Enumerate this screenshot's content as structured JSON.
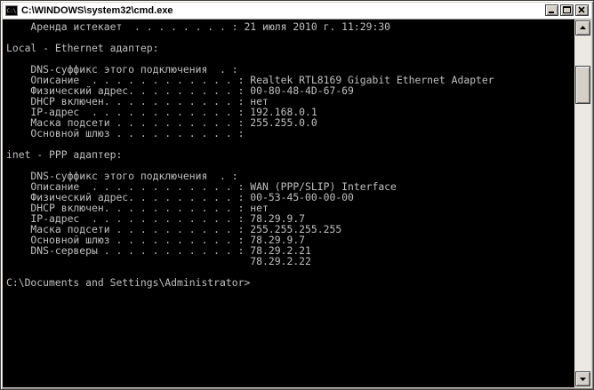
{
  "window": {
    "title": "C:\\WINDOWS\\system32\\cmd.exe",
    "icon_label": "C:\\"
  },
  "console": {
    "lines": [
      "    Аренда истекает  . . . . . . . . : 21 июля 2010 г. 11:29:30",
      "",
      "Local - Ethernet адаптер:",
      "",
      "    DNS-суффикс этого подключения  . :",
      "    Описание  . . . . . . . . . . . . : Realtek RTL8169 Gigabit Ethernet Adapter",
      "    Физический адрес. . . . . . . . . : 00-80-48-4D-67-69",
      "    DHCP включен. . . . . . . . . . . : нет",
      "    IP-адрес  . . . . . . . . . . . . : 192.168.0.1",
      "    Маска подсети . . . . . . . . . . : 255.255.0.0",
      "    Основной шлюз . . . . . . . . . . :",
      "",
      "inet - PPP адаптер:",
      "",
      "    DNS-суффикс этого подключения  . :",
      "    Описание  . . . . . . . . . . . . : WAN (PPP/SLIP) Interface",
      "    Физический адрес. . . . . . . . . : 00-53-45-00-00-00",
      "    DHCP включен. . . . . . . . . . . : нет",
      "    IP-адрес  . . . . . . . . . . . . : 78.29.9.7",
      "    Маска подсети . . . . . . . . . . : 255.255.255.255",
      "    Основной шлюз . . . . . . . . . . : 78.29.9.7",
      "    DNS-серверы . . . . . . . . . . . : 78.29.2.21",
      "                                        78.29.2.22",
      "",
      "C:\\Documents and Settings\\Administrator>"
    ]
  },
  "scrollbar": {
    "position_fraction": 0.1
  },
  "colors": {
    "console_bg": "#000000",
    "console_fg": "#c0c0c0",
    "titlebar_bg": "#ffffff",
    "chrome": "#d4d0c8"
  },
  "icons": {
    "app": "cmd-icon",
    "minimize": "minimize-icon",
    "maximize": "maximize-icon",
    "close": "close-icon",
    "scroll_up": "arrow-up-icon",
    "scroll_down": "arrow-down-icon"
  }
}
